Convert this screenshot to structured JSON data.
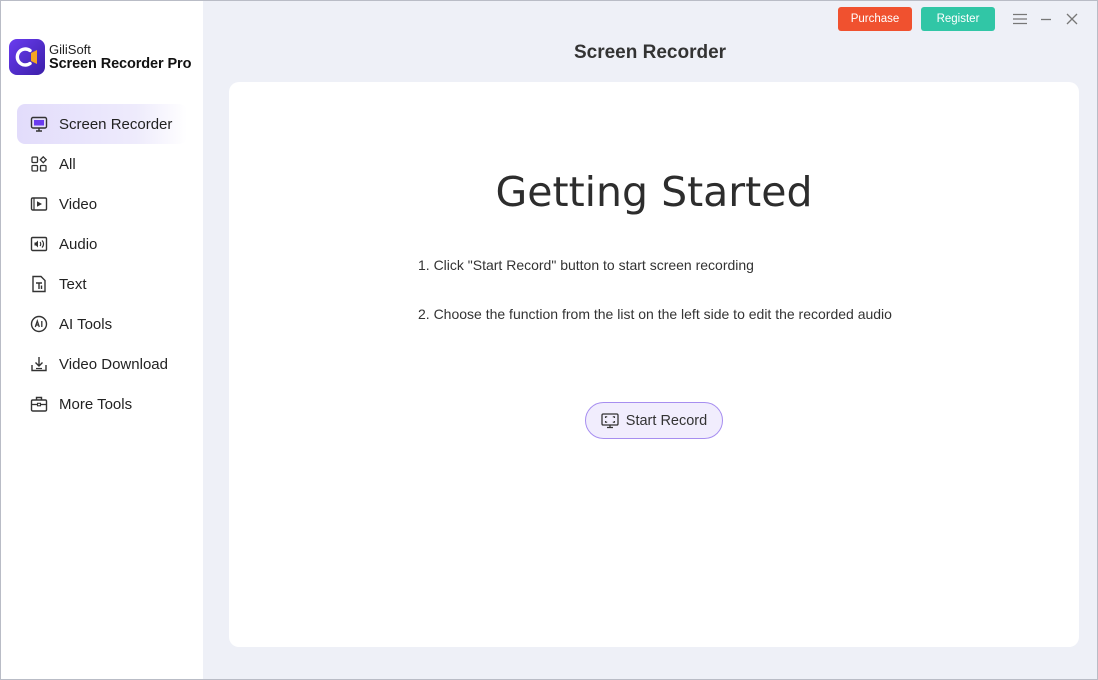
{
  "app": {
    "brand_small": "GiliSoft",
    "brand_big": "Screen Recorder Pro",
    "accent": "#6a3cf0"
  },
  "titlebar": {
    "purchase_label": "Purchase",
    "register_label": "Register",
    "purchase_color": "#f0512f",
    "register_color": "#31c6a6"
  },
  "sidebar": {
    "items": [
      {
        "label": "Screen Recorder",
        "icon": "monitor-icon",
        "active": true
      },
      {
        "label": "All",
        "icon": "grid-icon"
      },
      {
        "label": "Video",
        "icon": "video-icon"
      },
      {
        "label": "Audio",
        "icon": "audio-icon"
      },
      {
        "label": "Text",
        "icon": "text-icon"
      },
      {
        "label": "AI Tools",
        "icon": "ai-icon"
      },
      {
        "label": "Video Download",
        "icon": "download-icon"
      },
      {
        "label": "More Tools",
        "icon": "toolbox-icon"
      }
    ]
  },
  "main": {
    "title": "Screen Recorder",
    "heading": "Getting Started",
    "step1": "1. Click \"Start Record\" button to start screen recording",
    "step2": "2. Choose the function from the list on the left side to edit the recorded audio",
    "start_label": "Start Record"
  }
}
